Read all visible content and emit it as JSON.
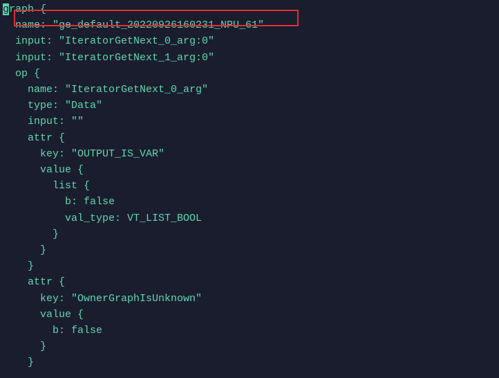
{
  "lines": {
    "l0a": "g",
    "l0b": "raph {",
    "l1": "  name: \"ge_default_20220926160231_NPU_61\"",
    "l2": "  input: \"IteratorGetNext_0_arg:0\"",
    "l3": "  input: \"IteratorGetNext_1_arg:0\"",
    "l4": "  op {",
    "l5": "    name: \"IteratorGetNext_0_arg\"",
    "l6": "    type: \"Data\"",
    "l7": "    input: \"\"",
    "l8": "    attr {",
    "l9": "      key: \"OUTPUT_IS_VAR\"",
    "l10": "      value {",
    "l11": "        list {",
    "l12": "          b: false",
    "l13": "          val_type: VT_LIST_BOOL",
    "l14": "        }",
    "l15": "      }",
    "l16": "    }",
    "l17": "    attr {",
    "l18": "      key: \"OwnerGraphIsUnknown\"",
    "l19": "      value {",
    "l20": "        b: false",
    "l21": "      }",
    "l22": "    }"
  }
}
